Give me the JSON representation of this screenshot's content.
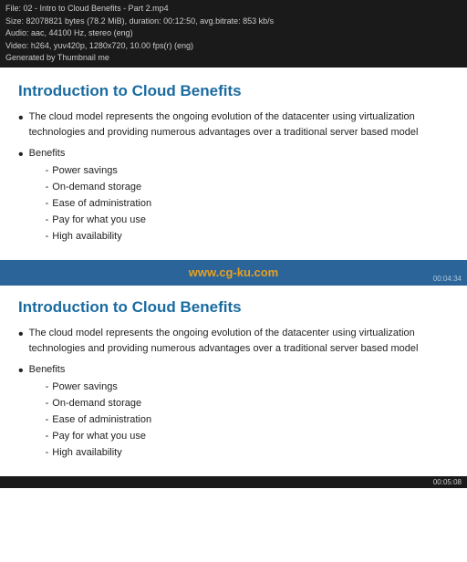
{
  "topbar": {
    "line1": "File: 02 - Intro to Cloud Benefits - Part 2.mp4",
    "line2": "Size: 82078821 bytes (78.2 MiB), duration: 00:12:50, avg.bitrate: 853 kb/s",
    "line3": "Audio: aac, 44100 Hz, stereo (eng)",
    "line4": "Video: h264, yuv420p, 1280x720, 10.00 fps(r) (eng)",
    "line5": "Generated by Thumbnail me"
  },
  "panel1": {
    "title": "Introduction to Cloud Benefits",
    "para": "The cloud model represents the ongoing evolution of the datacenter using virtualization technologies and providing numerous advantages over a traditional server based model",
    "benefits_label": "Benefits",
    "sub_items": [
      "Power savings",
      "On-demand storage",
      "Ease of administration",
      "Pay for what you use",
      "High availability"
    ]
  },
  "divider": {
    "watermark": "www.cg-ku.com",
    "timestamp": "00:04:34"
  },
  "panel2": {
    "title": "Introduction to Cloud Benefits",
    "para": "The cloud model represents the ongoing evolution of the datacenter using virtualization technologies and providing numerous advantages over a traditional server based model",
    "benefits_label": "Benefits",
    "sub_items": [
      "Power savings",
      "On-demand storage",
      "Ease of administration",
      "Pay for what you use",
      "High availability"
    ]
  },
  "bottombar": {
    "timestamp": "00:05:08"
  }
}
